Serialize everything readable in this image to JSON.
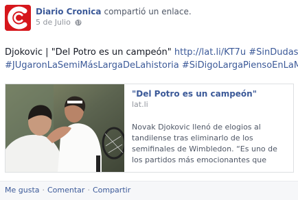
{
  "header": {
    "author": "Diario Cronica",
    "action": "compartió un enlace.",
    "date": "5 de Julio",
    "privacy_icon": "globe-icon",
    "avatar_color": "#d6171c"
  },
  "post": {
    "text_intro": "Djokovic | \"Del Potro es un campeón\"",
    "link": "http://lat.li/KT7u",
    "hashtags": [
      "#SinDudas",
      "#JUgaronLaSemiMásLargaDeLahistoria",
      "#SiDigoLargaPiensoEnLaMía"
    ]
  },
  "card": {
    "title": "\"Del Potro es un campeón\"",
    "domain": "lat.li",
    "description": "Novak Djokovic llenó de elogios al tandilense tras eliminarlo de los semifinales de Wimbledon. “Es uno de los partidos más emocionantes que"
  },
  "footer": {
    "like": "Me gusta",
    "comment": "Comentar",
    "share": "Compartir",
    "separator": "·"
  },
  "colors": {
    "link": "#3b5998",
    "meta": "#90949c",
    "brand": "#d6171c"
  }
}
